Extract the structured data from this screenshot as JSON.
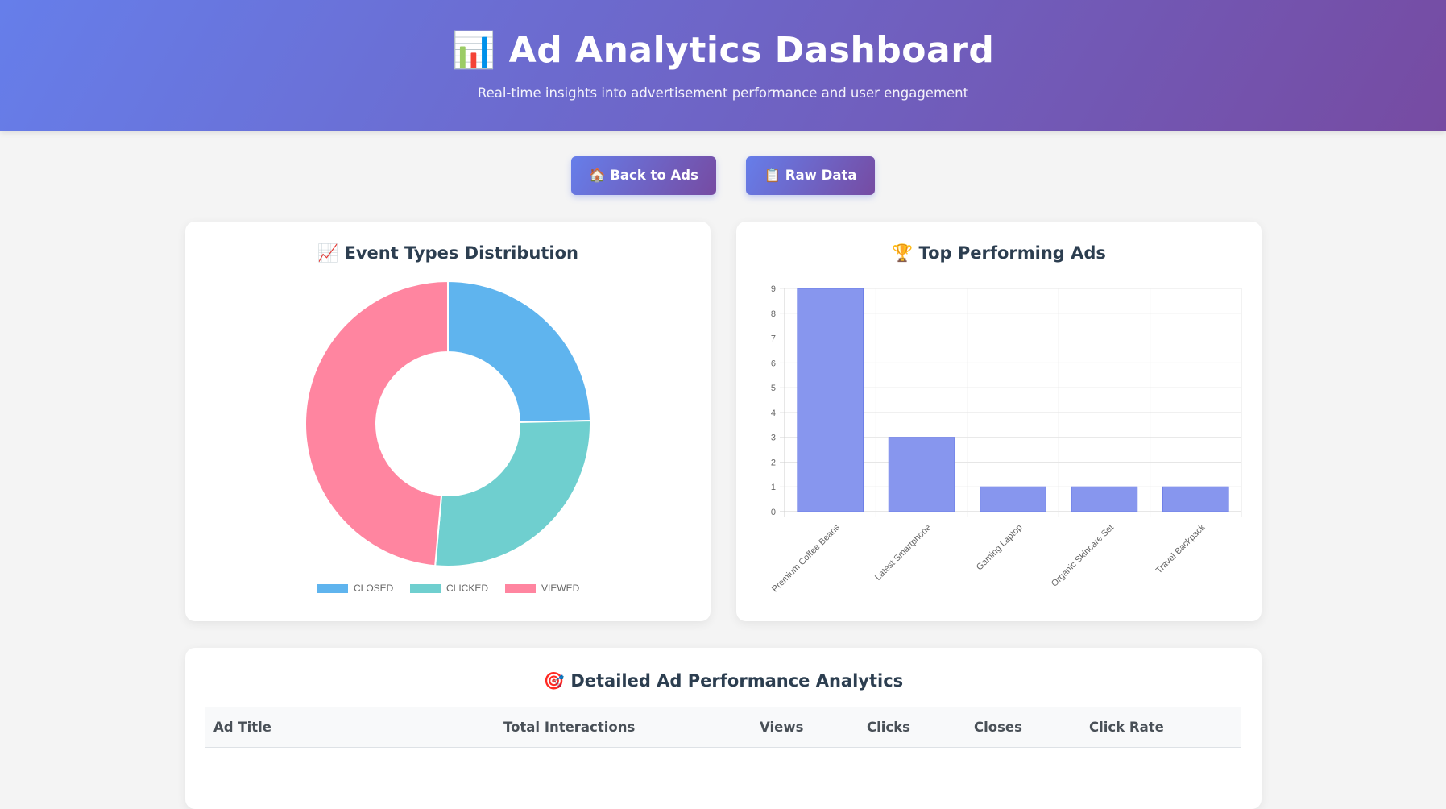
{
  "header": {
    "title": "📊 Ad Analytics Dashboard",
    "subtitle": "Real-time insights into advertisement performance and user engagement"
  },
  "actions": {
    "back_label": "🏠 Back to Ads",
    "raw_label": "📋 Raw Data"
  },
  "event_card": {
    "title": "📈 Event Types Distribution"
  },
  "top_card": {
    "title": "🏆 Top Performing Ads"
  },
  "table_card": {
    "title": "🎯 Detailed Ad Performance Analytics",
    "columns": [
      "Ad Title",
      "Total Interactions",
      "Views",
      "Clicks",
      "Closes",
      "Click Rate"
    ]
  },
  "colors": {
    "header_gradient": [
      "#667eea",
      "#764ba2"
    ],
    "closed": "#5fb4ee",
    "clicked": "#6fcfcf",
    "viewed": "#ff85a0",
    "bar": "#8796ee"
  },
  "chart_data": [
    {
      "type": "pie",
      "variant": "doughnut",
      "labels": [
        "CLOSED",
        "CLICKED",
        "VIEWED"
      ],
      "values": [
        3.45,
        3.75,
        6.8
      ],
      "colors": [
        "#5fb4ee",
        "#6fcfcf",
        "#ff85a0"
      ],
      "legend": "bottom"
    },
    {
      "type": "bar",
      "categories": [
        "Premium Coffee Beans",
        "Latest Smartphone",
        "Gaming Laptop",
        "Organic Skincare Set",
        "Travel Backpack"
      ],
      "values": [
        9,
        3,
        1,
        1,
        1
      ],
      "ylim": [
        0,
        9
      ],
      "yticks": [
        0,
        1,
        2,
        3,
        4,
        5,
        6,
        7,
        8,
        9
      ],
      "grid": true,
      "legend": "none"
    }
  ]
}
